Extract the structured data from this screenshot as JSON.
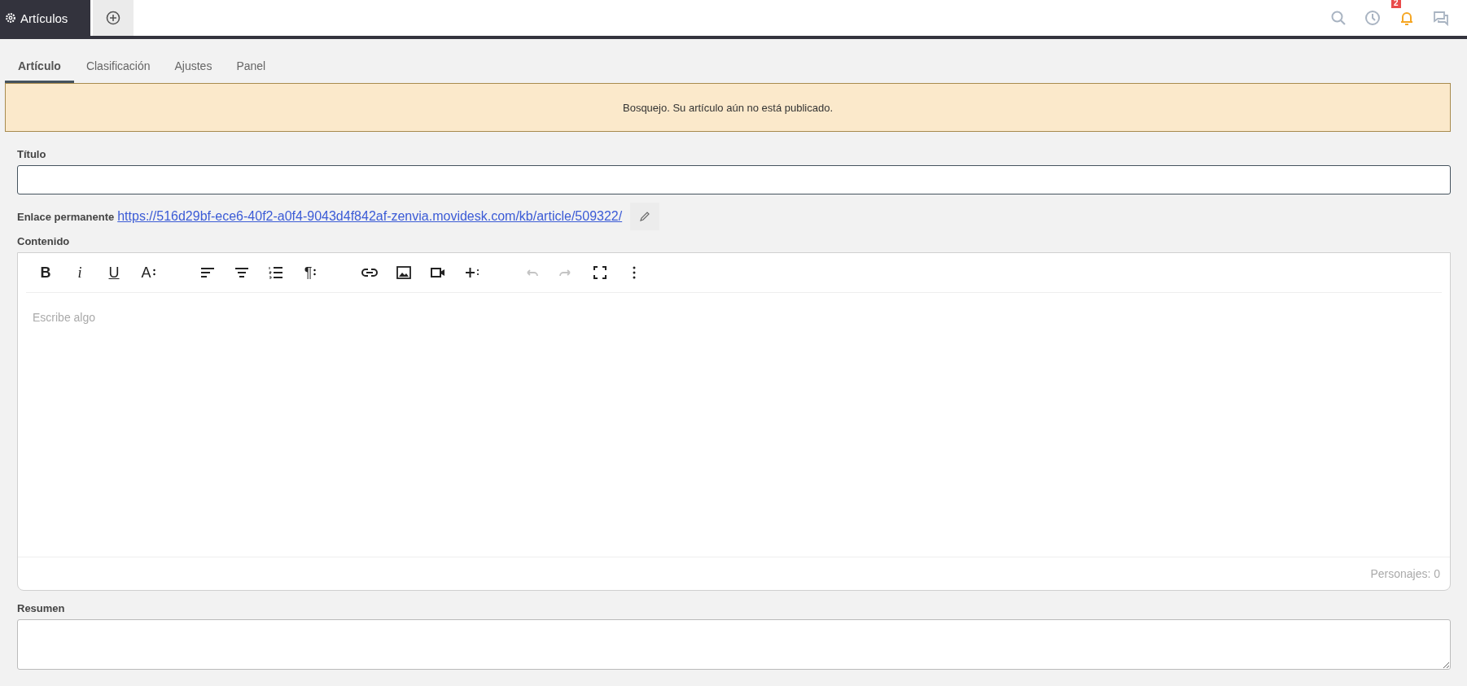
{
  "app_tabs": [
    {
      "label": "Artículos",
      "selected": true
    }
  ],
  "notifications": {
    "badge": "2"
  },
  "tabs": [
    {
      "label": "Artículo",
      "selected": true
    },
    {
      "label": "Clasificación",
      "selected": false
    },
    {
      "label": "Ajustes",
      "selected": false
    },
    {
      "label": "Panel",
      "selected": false
    }
  ],
  "banner": {
    "text": "Bosquejo. Su artículo aún no está publicado."
  },
  "title_field": {
    "label": "Título"
  },
  "permalink": {
    "label": "Enlace permanente",
    "url": "https://516d29bf-ece6-40f2-a0f4-9043d4f842af-zenvia.movidesk.com/kb/article/509322/"
  },
  "content": {
    "label": "Contenido",
    "placeholder": "Escribe algo",
    "counter": "Personajes: 0",
    "toolbar": [
      [
        {
          "kind": "bold",
          "label": "B",
          "disabled": false
        },
        {
          "kind": "italic",
          "label": "i",
          "disabled": false
        },
        {
          "kind": "underline",
          "label": "U",
          "disabled": false
        },
        {
          "kind": "font",
          "label": "A",
          "disabled": false
        }
      ],
      [
        {
          "kind": "align-left",
          "disabled": false
        },
        {
          "kind": "align-center",
          "disabled": false
        },
        {
          "kind": "list",
          "disabled": false
        },
        {
          "kind": "paragraph",
          "label": "¶",
          "disabled": false
        }
      ],
      [
        {
          "kind": "link",
          "disabled": false
        },
        {
          "kind": "image",
          "disabled": false
        },
        {
          "kind": "video",
          "disabled": false
        },
        {
          "kind": "insert",
          "disabled": false
        }
      ],
      [
        {
          "kind": "undo",
          "disabled": true
        },
        {
          "kind": "redo",
          "disabled": true
        },
        {
          "kind": "fullscreen",
          "disabled": false
        },
        {
          "kind": "more",
          "disabled": false
        }
      ]
    ]
  },
  "summary": {
    "label": "Resumen"
  }
}
